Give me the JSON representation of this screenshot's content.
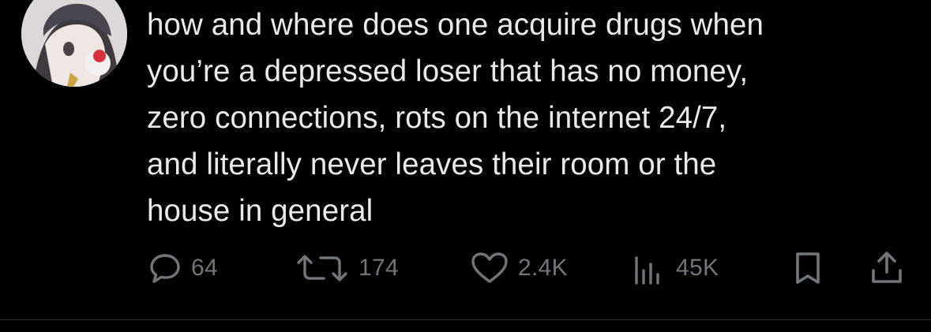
{
  "tweet": {
    "text": "how and where does one acquire drugs when\nyou’re a depressed loser that has no money,\nzero connections, rots on the internet 24/7,\nand literally never leaves their room or the\nhouse in general"
  },
  "actions": {
    "reply": {
      "icon": "reply-icon",
      "count": "64"
    },
    "retweet": {
      "icon": "retweet-icon",
      "count": "174"
    },
    "like": {
      "icon": "heart-icon",
      "count": "2.4K"
    },
    "views": {
      "icon": "views-icon",
      "count": "45K"
    },
    "bookmark": {
      "icon": "bookmark-icon"
    },
    "share": {
      "icon": "share-icon"
    }
  },
  "colors": {
    "background": "#000000",
    "text": "#e7e9ea",
    "muted": "#71767b",
    "divider": "#2f3336"
  }
}
